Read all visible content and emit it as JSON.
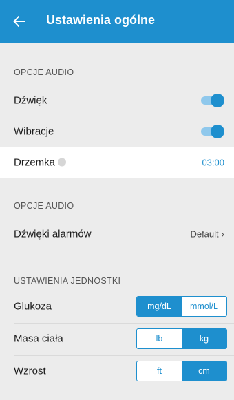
{
  "header": {
    "title": "Ustawienia ogólne",
    "back_icon": "arrow-left-icon"
  },
  "audio_section": {
    "label": "OPCJE AUDIO",
    "sound": {
      "label": "Dźwięk",
      "enabled": true
    },
    "vibration": {
      "label": "Wibracje",
      "enabled": true
    },
    "snooze": {
      "label": "Drzemka",
      "value": "03:00"
    }
  },
  "alarm_section": {
    "label": "OPCJE AUDIO",
    "alarm_sounds": {
      "label": "Dźwięki alarmów",
      "value": "Default",
      "chevron": "›"
    }
  },
  "units_section": {
    "label": "USTAWIENIA JEDNOSTKI",
    "glucose": {
      "label": "Glukoza",
      "options": [
        "mg/dL",
        "mmol/L"
      ],
      "selected": "mg/dL"
    },
    "weight": {
      "label": "Masa ciała",
      "options": [
        "lb",
        "kg"
      ],
      "selected": "kg"
    },
    "height": {
      "label": "Wzrost",
      "options": [
        "ft",
        "cm"
      ],
      "selected": "cm"
    }
  },
  "colors": {
    "accent": "#1e8fce",
    "background": "#ececec",
    "highlight_row": "#ffffff"
  }
}
